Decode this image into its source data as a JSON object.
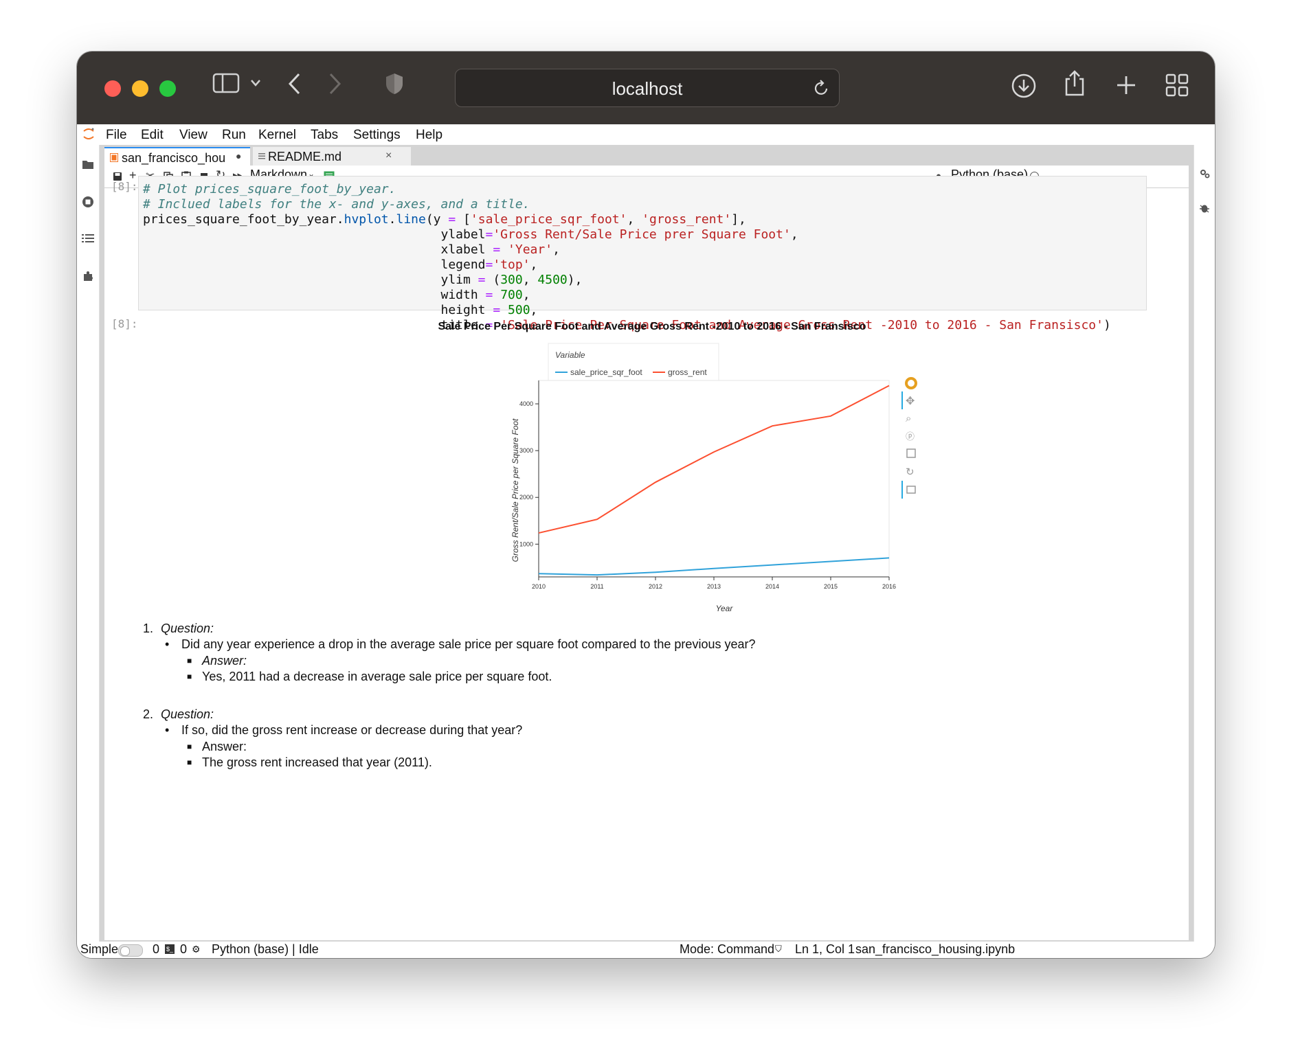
{
  "browser": {
    "url": "localhost",
    "icons": [
      "sidebar-icon",
      "chevron-down-icon",
      "back-icon",
      "forward-icon",
      "shield-icon",
      "reload-icon",
      "download-icon",
      "share-icon",
      "plus-icon",
      "tabs-grid-icon"
    ]
  },
  "menu": [
    "File",
    "Edit",
    "View",
    "Run",
    "Kernel",
    "Tabs",
    "Settings",
    "Help"
  ],
  "tabs": [
    {
      "label": "san_francisco_hou"
    },
    {
      "label": "README.md"
    }
  ],
  "toolbar": {
    "cell_type": "Markdown",
    "kernel": "Python (base)"
  },
  "cells": {
    "code_prompt": "[8]:",
    "output_prompt": "[8]:"
  },
  "chart_data": {
    "type": "line",
    "title": "Sale Price Per Square Foot and Average Gross Rent -2010 to 2016 - San Fransisco",
    "xlabel": "Year",
    "ylabel": "Gross Rent/Sale Price per Square Foot",
    "legend_title": "Variable",
    "legend_position": "top",
    "ylim": [
      300,
      4500
    ],
    "xlim": [
      2010,
      2016
    ],
    "x": [
      2010,
      2011,
      2012,
      2013,
      2014,
      2015,
      2016
    ],
    "x_ticks": [
      "2010",
      "2011",
      "2012",
      "2013",
      "2014",
      "2015",
      "2016"
    ],
    "y_ticks": [
      "1000",
      "2000",
      "3000",
      "4000"
    ],
    "series": [
      {
        "name": "sale_price_sqr_foot",
        "color": "#30a2da",
        "values": [
          369,
          342,
          399,
          480,
          555,
          630,
          705
        ]
      },
      {
        "name": "gross_rent",
        "color": "#fc4f30",
        "values": [
          1239,
          1530,
          2324,
          2971,
          3528,
          3739,
          4390
        ]
      }
    ]
  },
  "markdown": {
    "q1_num": "1.",
    "q1_label": "Question:",
    "q1_text": "Did any year experience a drop in the average sale price per square foot compared to the previous year?",
    "q1_answer_label": "Answer:",
    "q1_answer": "Yes, 2011 had a decrease in average sale price per square foot.",
    "q2_num": "2.",
    "q2_label": "Question:",
    "q2_text": "If so, did the gross rent increase or decrease during that year?",
    "q2_answer_label": "Answer:",
    "q2_answer": "The gross rent increased that year (2011)."
  },
  "status": {
    "mode_label": "Simple",
    "count_a": "0",
    "count_b": "0",
    "kernel_status": "Python (base) | Idle",
    "mode": "Mode: Command",
    "position": "Ln 1, Col 1",
    "filename": "san_francisco_housing.ipynb"
  }
}
